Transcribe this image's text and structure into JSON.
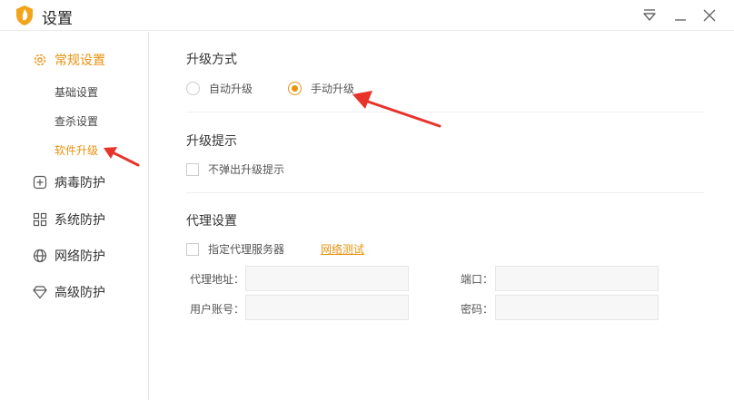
{
  "window": {
    "title": "设置",
    "controls": [
      "menu-icon",
      "minimize-icon",
      "close-icon"
    ]
  },
  "sidebar": {
    "groups": [
      {
        "label": "常规设置",
        "icon": "gear-icon",
        "active": true,
        "subitems": [
          {
            "label": "基础设置",
            "active": false
          },
          {
            "label": "查杀设置",
            "active": false
          },
          {
            "label": "软件升级",
            "active": true
          }
        ]
      },
      {
        "label": "病毒防护",
        "icon": "plus-square-icon",
        "active": false
      },
      {
        "label": "系统防护",
        "icon": "grid-icon",
        "active": false
      },
      {
        "label": "网络防护",
        "icon": "globe-icon",
        "active": false
      },
      {
        "label": "高级防护",
        "icon": "diamond-icon",
        "active": false
      }
    ]
  },
  "main": {
    "upgrade_mode": {
      "title": "升级方式",
      "options": [
        {
          "label": "自动升级",
          "selected": false
        },
        {
          "label": "手动升级",
          "selected": true
        }
      ]
    },
    "upgrade_prompt": {
      "title": "升级提示",
      "checkbox_label": "不弹出升级提示",
      "checked": false
    },
    "proxy": {
      "title": "代理设置",
      "checkbox_label": "指定代理服务器",
      "checked": false,
      "test_link": "网络测试",
      "fields": {
        "address_label": "代理地址：",
        "address_value": "",
        "port_label": "端口：",
        "port_value": "",
        "account_label": "用户账号：",
        "account_value": "",
        "password_label": "密码：",
        "password_value": ""
      }
    }
  },
  "colors": {
    "accent": "#e8920f",
    "annotation_arrow": "#e8332a"
  }
}
